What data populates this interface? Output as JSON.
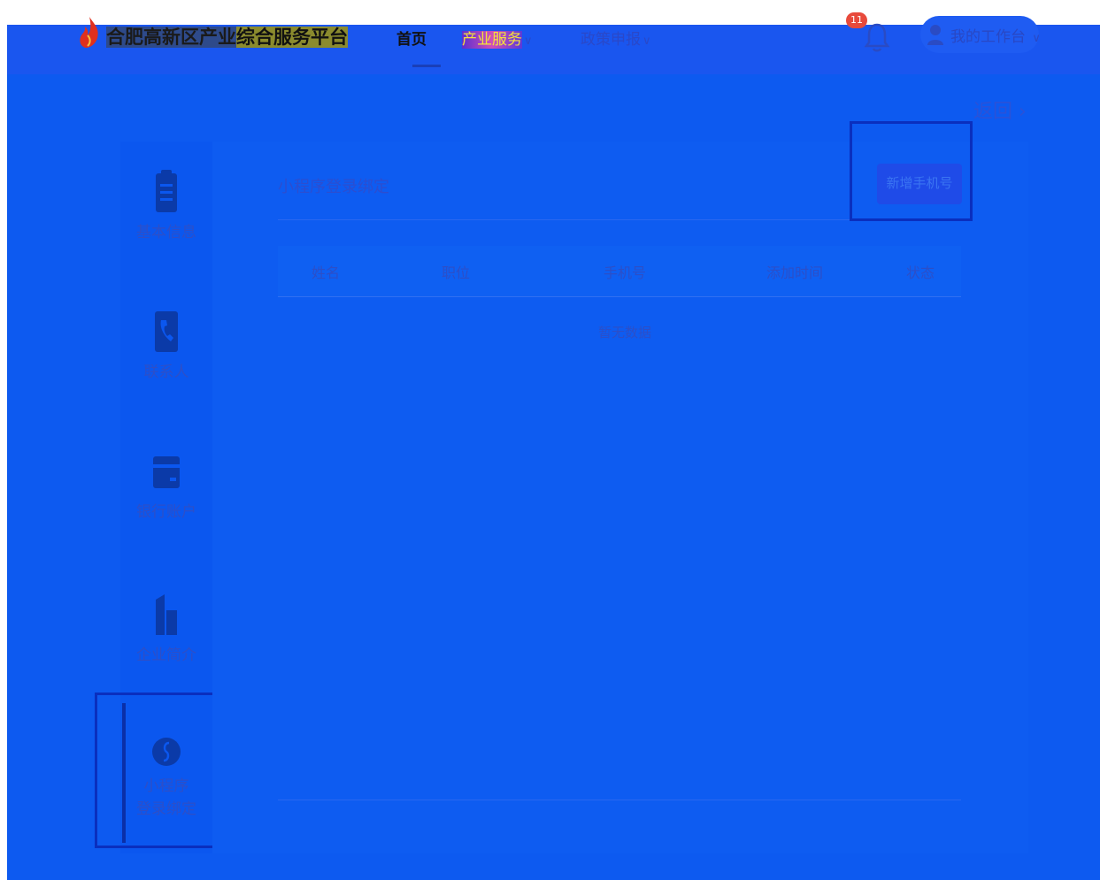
{
  "header": {
    "brand_a": "合肥高新区产业",
    "brand_b": "综合服务平台",
    "nav": {
      "home": "首页",
      "industry": "产业服务",
      "policy": "政策申报"
    },
    "notification_count": "11",
    "workbench_label": "我的工作台"
  },
  "back_label": "返回 ›",
  "sidebar": {
    "items": [
      {
        "label": "基本信息",
        "icon": "document-icon"
      },
      {
        "label": "联系人",
        "icon": "contact-book-icon"
      },
      {
        "label": "银行账户",
        "icon": "bank-card-icon"
      },
      {
        "label": "企业简介",
        "icon": "building-icon"
      },
      {
        "label_line1": "小程序",
        "label_line2": "登录绑定",
        "icon": "mini-program-icon"
      }
    ]
  },
  "main": {
    "title": "小程序登录绑定",
    "add_button": "新增手机号",
    "table": {
      "columns": [
        "姓名",
        "职位",
        "手机号",
        "添加时间",
        "状态"
      ],
      "empty_text": "暂无数据"
    }
  },
  "colors": {
    "page_blue": "#0d5af0",
    "header_band": "#1a56ef",
    "highlight_border": "#0a2fbe",
    "badge": "#e84a3c"
  }
}
